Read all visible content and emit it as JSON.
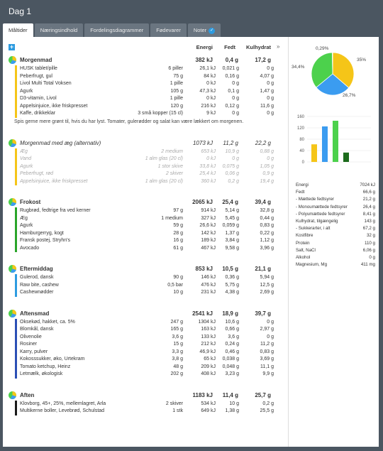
{
  "window": {
    "title": "Dag 1"
  },
  "tabs": [
    {
      "label": "Måltider",
      "active": true
    },
    {
      "label": "Næringsindhold",
      "active": false
    },
    {
      "label": "Fordelingsdiagrammer",
      "active": false
    },
    {
      "label": "Fødevarer",
      "active": false
    },
    {
      "label": "Noter",
      "active": false
    }
  ],
  "columns": {
    "energy": "Energi",
    "fat": "Fedt",
    "carbs": "Kulhydrat",
    "expand": "»",
    "add": "+"
  },
  "colors": {
    "protein": "#3b9cf0",
    "fat": "#f5c518",
    "carbs": "#4cd14c",
    "alcohol": "#1b6b1b",
    "bar_breakfast": "#f5c518",
    "bar_lunch": "#2aa52a",
    "bar_afternoon": "#4cd14c",
    "bar_dinner": "#2b4fb5",
    "bar_evening": "#1a1a1a"
  },
  "meals": [
    {
      "name": "Morgenmad",
      "energy": "382 kJ",
      "fat": "0,4 g",
      "carbs": "17,2 g",
      "alternative": false,
      "bar": "#f5c518",
      "items": [
        {
          "name": "HUSK tablet/pille",
          "amount": "6 piller",
          "energy": "26,1 kJ",
          "fat": "0,021 g",
          "carbs": "0 g"
        },
        {
          "name": "Peberfrugt, gul",
          "amount": "75 g",
          "energy": "84 kJ",
          "fat": "0,16 g",
          "carbs": "4,07 g"
        },
        {
          "name": "Livol Multi Total Voksen",
          "amount": "1 pille",
          "energy": "0 kJ",
          "fat": "0 g",
          "carbs": "0 g"
        },
        {
          "name": "Agurk",
          "amount": "105 g",
          "energy": "47,3 kJ",
          "fat": "0,1 g",
          "carbs": "1,47 g"
        },
        {
          "name": "D3-vitamin, Livol",
          "amount": "1 pille",
          "energy": "0 kJ",
          "fat": "0 g",
          "carbs": "0 g"
        },
        {
          "name": "Appelsinjuice, ikke friskpresset",
          "amount": "120 g",
          "energy": "216 kJ",
          "fat": "0,12 g",
          "carbs": "11,6 g"
        },
        {
          "name": "Kaffe, drikkeklar",
          "amount": "3 små kopper (15 cl)",
          "energy": "9 kJ",
          "fat": "0 g",
          "carbs": "0 g"
        }
      ],
      "note": "Spis gerne mere grønt til, hvis du har lyst. Tomater, gulerødder og salat kan være lækkert om morgenen."
    },
    {
      "name": "Morgenmad med æg (alternativ)",
      "energy": "1073 kJ",
      "fat": "11,2 g",
      "carbs": "22,2 g",
      "alternative": true,
      "bar": "#f5c518",
      "items": [
        {
          "name": "Æg",
          "amount": "2 medium",
          "energy": "653 kJ",
          "fat": "10,9 g",
          "carbs": "0,88 g"
        },
        {
          "name": "Vand",
          "amount": "1 alm glas (20 cl)",
          "energy": "0 kJ",
          "fat": "0 g",
          "carbs": "0 g"
        },
        {
          "name": "Agurk",
          "amount": "1 stor skive",
          "energy": "33,8 kJ",
          "fat": "0,075 g",
          "carbs": "1,05 g"
        },
        {
          "name": "Peberfrugt, rød",
          "amount": "2 skiver",
          "energy": "25,4 kJ",
          "fat": "0,06 g",
          "carbs": "0,9 g"
        },
        {
          "name": "Appelsinjuice, ikke friskpresset",
          "amount": "1 alm glas (20 cl)",
          "energy": "360 kJ",
          "fat": "0,2 g",
          "carbs": "19,4 g"
        }
      ]
    },
    {
      "name": "Frokost",
      "energy": "2065 kJ",
      "fat": "25,4 g",
      "carbs": "39,4 g",
      "alternative": false,
      "bar": "#2aa52a",
      "items": [
        {
          "name": "Rugbrød, fedtrige fra ved kerner",
          "amount": "97 g",
          "energy": "914 kJ",
          "fat": "5,14 g",
          "carbs": "32,8 g"
        },
        {
          "name": "Æg",
          "amount": "1 medium",
          "energy": "327 kJ",
          "fat": "5,45 g",
          "carbs": "0,44 g"
        },
        {
          "name": "Agurk",
          "amount": "59 g",
          "energy": "26,6 kJ",
          "fat": "0,059 g",
          "carbs": "0,83 g"
        },
        {
          "name": "Hamburgerryg, kogt",
          "amount": "28 g",
          "energy": "142 kJ",
          "fat": "1,37 g",
          "carbs": "0,22 g"
        },
        {
          "name": "Fransk postej, Stryhn's",
          "amount": "16 g",
          "energy": "189 kJ",
          "fat": "3,84 g",
          "carbs": "1,12 g"
        },
        {
          "name": "Avocado",
          "amount": "61 g",
          "energy": "467 kJ",
          "fat": "9,58 g",
          "carbs": "3,96 g"
        }
      ]
    },
    {
      "name": "Eftermiddag",
      "energy": "853 kJ",
      "fat": "10,5 g",
      "carbs": "21,1 g",
      "alternative": false,
      "bar": "#2d9be0",
      "items": [
        {
          "name": "Gulerod, dansk",
          "amount": "90 g",
          "energy": "146 kJ",
          "fat": "0,36 g",
          "carbs": "5,94 g"
        },
        {
          "name": "Raw bite, cashew",
          "amount": "0,5 bar",
          "energy": "476 kJ",
          "fat": "5,75 g",
          "carbs": "12,5 g"
        },
        {
          "name": "Cashewnødder",
          "amount": "10 g",
          "energy": "231 kJ",
          "fat": "4,38 g",
          "carbs": "2,69 g"
        }
      ]
    },
    {
      "name": "Aftensmad",
      "energy": "2541 kJ",
      "fat": "18,9 g",
      "carbs": "39,7 g",
      "alternative": false,
      "bar": "#2b4fb5",
      "items": [
        {
          "name": "Oksekød, hakket, ca. 5%",
          "amount": "247 g",
          "energy": "1304 kJ",
          "fat": "10,6 g",
          "carbs": "0 g"
        },
        {
          "name": "Blomkål, dansk",
          "amount": "165 g",
          "energy": "163 kJ",
          "fat": "0,66 g",
          "carbs": "2,97 g"
        },
        {
          "name": "Olivenolie",
          "amount": "3,6 g",
          "energy": "133 kJ",
          "fat": "3,6 g",
          "carbs": "0 g"
        },
        {
          "name": "Rosiner",
          "amount": "15 g",
          "energy": "212 kJ",
          "fat": "0,24 g",
          "carbs": "11,2 g"
        },
        {
          "name": "Karry, pulver",
          "amount": "3,3 g",
          "energy": "46,9 kJ",
          "fat": "0,46 g",
          "carbs": "0,83 g"
        },
        {
          "name": "Kokosssukker, øko, Urtekram",
          "amount": "3,8 g",
          "energy": "65 kJ",
          "fat": "0,038 g",
          "carbs": "3,69 g"
        },
        {
          "name": "Tomato ketchup, Heinz",
          "amount": "48 g",
          "energy": "209 kJ",
          "fat": "0,048 g",
          "carbs": "11,1 g"
        },
        {
          "name": "Letmælk, økologisk",
          "amount": "202 g",
          "energy": "408 kJ",
          "fat": "3,23 g",
          "carbs": "9,9 g"
        }
      ]
    },
    {
      "name": "Aften",
      "energy": "1183 kJ",
      "fat": "11,4 g",
      "carbs": "25,7 g",
      "alternative": false,
      "bar": "#1a1a1a",
      "items": [
        {
          "name": "Klovborg, 45+, 25%, mellemlagret, Arla",
          "amount": "2 skiver",
          "energy": "534 kJ",
          "fat": "10 g",
          "carbs": "0,2 g"
        },
        {
          "name": "Multikerne boller, Levebrød, Schulstad",
          "amount": "1 stk",
          "energy": "649 kJ",
          "fat": "1,38 g",
          "carbs": "25,5 g"
        }
      ]
    }
  ],
  "sidebar": {
    "pie": [
      {
        "label": "35%",
        "value": 35,
        "color": "#f5c518"
      },
      {
        "label": "26,7%",
        "value": 26.7,
        "color": "#3b9cf0"
      },
      {
        "label": "34,4%",
        "value": 34.4,
        "color": "#4cd14c"
      },
      {
        "label": "0,29%",
        "value": 0.29,
        "color": "#1b6b1b"
      }
    ],
    "bar_chart": {
      "type": "bar",
      "ylim": [
        0,
        160
      ],
      "yticks": [
        "0",
        "40",
        "80",
        "120",
        "160"
      ],
      "values": [
        62,
        125,
        145,
        33
      ],
      "colors": [
        "#f5c518",
        "#3b9cf0",
        "#4cd14c",
        "#1b6b1b"
      ]
    },
    "nutrients": [
      {
        "label": "Energi",
        "value": "7024 kJ"
      },
      {
        "label": "Fedt",
        "value": "66,6 g"
      },
      {
        "label": "- Mættede fedtsyrer",
        "value": "21,2 g"
      },
      {
        "label": "- Monoumættede fedtsyrer",
        "value": "26,4 g"
      },
      {
        "label": "- Polyumættede fedtsyrer",
        "value": "8,41 g"
      },
      {
        "label": "Kulhydrat, tilgængelig",
        "value": "143 g"
      },
      {
        "label": "- Sukkerarter, i alt",
        "value": "67,2 g"
      },
      {
        "label": "Kostfibre",
        "value": "32 g"
      },
      {
        "label": "Protein",
        "value": "110 g"
      },
      {
        "label": "Salt, NaCl",
        "value": "6,06 g"
      },
      {
        "label": "Alkohol",
        "value": "0 g"
      },
      {
        "label": "Magnesium, Mg",
        "value": "411 mg"
      }
    ]
  }
}
